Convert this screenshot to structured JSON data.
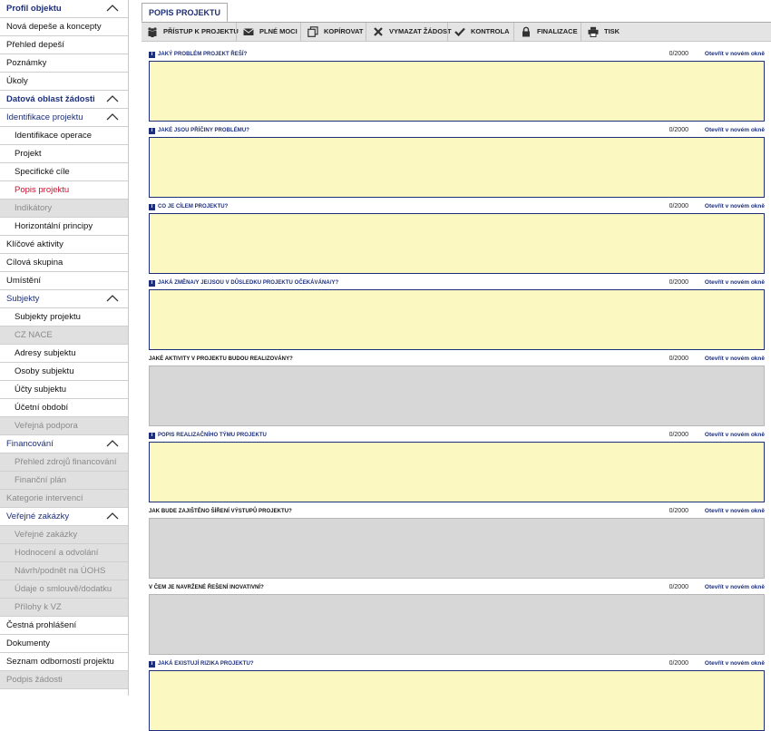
{
  "sidebar": {
    "items": [
      {
        "label": "Profil objektu",
        "kind": "section",
        "chevron": true
      },
      {
        "label": "Nová depeše a koncepty",
        "kind": "top"
      },
      {
        "label": "Přehled depeší",
        "kind": "top"
      },
      {
        "label": "Poznámky",
        "kind": "top"
      },
      {
        "label": "Úkoly",
        "kind": "top"
      },
      {
        "label": "Datová oblast žádosti",
        "kind": "section",
        "chevron": true
      },
      {
        "label": "Identifikace projektu",
        "kind": "group",
        "chevron": true
      },
      {
        "label": "Identifikace operace",
        "kind": "sub"
      },
      {
        "label": "Projekt",
        "kind": "sub"
      },
      {
        "label": "Specifické cíle",
        "kind": "sub"
      },
      {
        "label": "Popis projektu",
        "kind": "sub",
        "active": true
      },
      {
        "label": "Indikátory",
        "kind": "sub",
        "disabled": true
      },
      {
        "label": "Horizontální principy",
        "kind": "sub"
      },
      {
        "label": "Klíčové aktivity",
        "kind": "top"
      },
      {
        "label": "Cílová skupina",
        "kind": "top"
      },
      {
        "label": "Umístění",
        "kind": "top"
      },
      {
        "label": "Subjekty",
        "kind": "group",
        "chevron": true
      },
      {
        "label": "Subjekty projektu",
        "kind": "sub"
      },
      {
        "label": "CZ NACE",
        "kind": "sub",
        "disabled": true
      },
      {
        "label": "Adresy subjektu",
        "kind": "sub"
      },
      {
        "label": "Osoby subjektu",
        "kind": "sub"
      },
      {
        "label": "Účty subjektu",
        "kind": "sub"
      },
      {
        "label": "Účetní období",
        "kind": "sub"
      },
      {
        "label": "Veřejná podpora",
        "kind": "sub",
        "disabled": true
      },
      {
        "label": "Financování",
        "kind": "group",
        "chevron": true
      },
      {
        "label": "Přehled zdrojů financování",
        "kind": "sub",
        "disabled": true
      },
      {
        "label": "Finanční plán",
        "kind": "sub",
        "disabled": true
      },
      {
        "label": "Kategorie intervencí",
        "kind": "top",
        "disabled": true
      },
      {
        "label": "Veřejné zakázky",
        "kind": "group",
        "chevron": true
      },
      {
        "label": "Veřejné zakázky",
        "kind": "sub",
        "disabled": true
      },
      {
        "label": "Hodnocení a odvolání",
        "kind": "sub",
        "disabled": true
      },
      {
        "label": "Návrh/podnět na ÚOHS",
        "kind": "sub",
        "disabled": true
      },
      {
        "label": "Údaje o smlouvě/dodatku",
        "kind": "sub",
        "disabled": true
      },
      {
        "label": "Přílohy k VZ",
        "kind": "sub",
        "disabled": true
      },
      {
        "label": "Čestná prohlášení",
        "kind": "top"
      },
      {
        "label": "Dokumenty",
        "kind": "top"
      },
      {
        "label": "Seznam odborností projektu",
        "kind": "top"
      },
      {
        "label": "Podpis žádosti",
        "kind": "top",
        "disabled": true
      }
    ]
  },
  "tab": {
    "label": "POPIS PROJEKTU"
  },
  "toolbar": {
    "buttons": [
      {
        "label": "PŘÍSTUP K PROJEKTU",
        "icon": "people-icon"
      },
      {
        "label": "PLNÉ MOCI",
        "icon": "envelope-icon"
      },
      {
        "label": "KOPÍROVAT",
        "icon": "copy-icon"
      },
      {
        "label": "VYMAZAT ŽÁDOST",
        "icon": "close-icon"
      },
      {
        "label": "KONTROLA",
        "icon": "check-icon"
      },
      {
        "label": "FINALIZACE",
        "icon": "lock-icon"
      },
      {
        "label": "TISK",
        "icon": "printer-icon"
      }
    ]
  },
  "fields": [
    {
      "label": "JAKÝ PROBLÉM PROJEKT ŘEŠÍ?",
      "counter": "0/2000",
      "link": "Otevřít v novém okně",
      "editable": true,
      "info": true
    },
    {
      "label": "JAKÉ JSOU PŘÍČINY PROBLÉMU?",
      "counter": "0/2000",
      "link": "Otevřít v novém okně",
      "editable": true,
      "info": true
    },
    {
      "label": "CO JE CÍLEM PROJEKTU?",
      "counter": "0/2000",
      "link": "Otevřít v novém okně",
      "editable": true,
      "info": true
    },
    {
      "label": "JAKÁ ZMĚNA/Y JE/JSOU V DŮSLEDKU PROJEKTU OČEKÁVÁNA/Y?",
      "counter": "0/2000",
      "link": "Otevřít v novém okně",
      "editable": true,
      "info": true
    },
    {
      "label": "JAKÉ AKTIVITY V PROJEKTU BUDOU REALIZOVÁNY?",
      "counter": "0/2000",
      "link": "Otevřít v novém okně",
      "editable": false,
      "info": false
    },
    {
      "label": "POPIS REALIZAČNÍHO TÝMU PROJEKTU",
      "counter": "0/2000",
      "link": "Otevřít v novém okně",
      "editable": true,
      "info": true
    },
    {
      "label": "JAK BUDE ZAJIŠTĚNO ŠÍŘENÍ VÝSTUPŮ PROJEKTU?",
      "counter": "0/2000",
      "link": "Otevřít v novém okně",
      "editable": false,
      "info": false
    },
    {
      "label": "V ČEM JE NAVRŽENÉ ŘEŠENÍ INOVATIVNÍ?",
      "counter": "0/2000",
      "link": "Otevřít v novém okně",
      "editable": false,
      "info": false
    },
    {
      "label": "JAKÁ EXISTUJÍ RIZIKA PROJEKTU?",
      "counter": "0/2000",
      "link": "Otevřít v novém okně",
      "editable": true,
      "info": true
    }
  ],
  "colors": {
    "brand": "#1d2f7a",
    "active": "#c8102e",
    "editable_bg": "#fbf9c1",
    "readonly_bg": "#d7d7d7"
  }
}
